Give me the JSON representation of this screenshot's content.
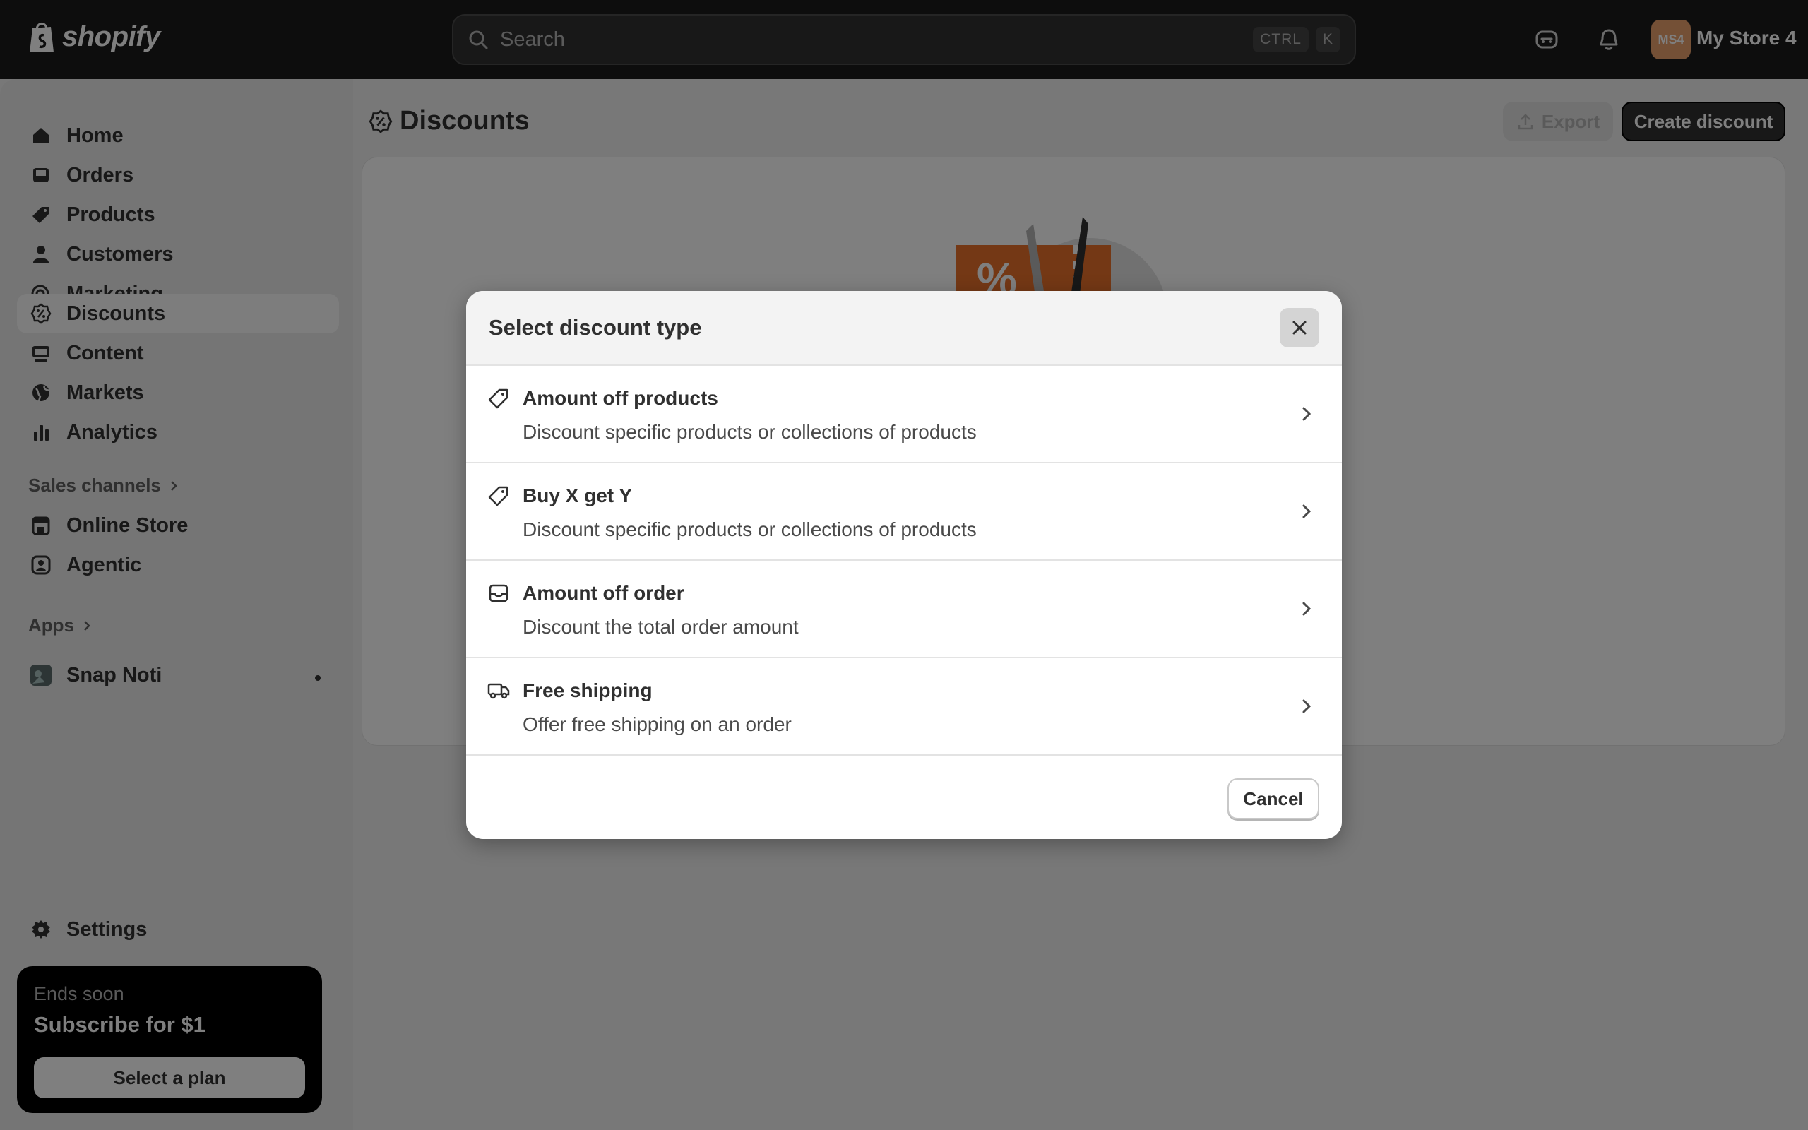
{
  "topbar": {
    "logo_text": "shopify",
    "search_placeholder": "Search",
    "shortcut_keys": [
      "CTRL",
      "K"
    ],
    "avatar_initials": "MS4",
    "store_name": "My Store 4"
  },
  "sidebar": {
    "items": [
      {
        "label": "Home",
        "icon": "home-icon"
      },
      {
        "label": "Orders",
        "icon": "inbox-icon"
      },
      {
        "label": "Products",
        "icon": "tag-icon"
      },
      {
        "label": "Customers",
        "icon": "person-icon"
      },
      {
        "label": "Marketing",
        "icon": "target-icon"
      },
      {
        "label": "Discounts",
        "icon": "discount-icon",
        "active": true
      },
      {
        "label": "Content",
        "icon": "content-icon"
      },
      {
        "label": "Markets",
        "icon": "globe-icon"
      },
      {
        "label": "Analytics",
        "icon": "bar-chart-icon"
      }
    ],
    "sales_channels_label": "Sales channels",
    "channels": [
      {
        "label": "Online Store",
        "icon": "store-icon"
      },
      {
        "label": "Agentic",
        "icon": "robot-icon"
      }
    ],
    "apps_label": "Apps",
    "apps": [
      {
        "label": "Snap Noti",
        "icon": "app-icon"
      }
    ],
    "settings_label": "Settings"
  },
  "trial": {
    "small_text": "Ends soon",
    "big_text": "Subscribe for $1",
    "button_label": "Select a plan"
  },
  "page": {
    "title": "Discounts",
    "export_label": "Export",
    "create_label": "Create discount"
  },
  "modal": {
    "title": "Select discount type",
    "options": [
      {
        "title": "Amount off products",
        "description": "Discount specific products or collections of products",
        "icon": "tag-icon"
      },
      {
        "title": "Buy X get Y",
        "description": "Discount specific products or collections of products",
        "icon": "tag-icon"
      },
      {
        "title": "Amount off order",
        "description": "Discount the total order amount",
        "icon": "cart-icon"
      },
      {
        "title": "Free shipping",
        "description": "Offer free shipping on an order",
        "icon": "truck-icon"
      }
    ],
    "cancel_label": "Cancel"
  },
  "colors": {
    "topbar": "#1a1a1a",
    "primary_button": "#303030",
    "illustration_orange": "#e8702a",
    "overlay": "rgba(0,0,0,0.5)"
  }
}
